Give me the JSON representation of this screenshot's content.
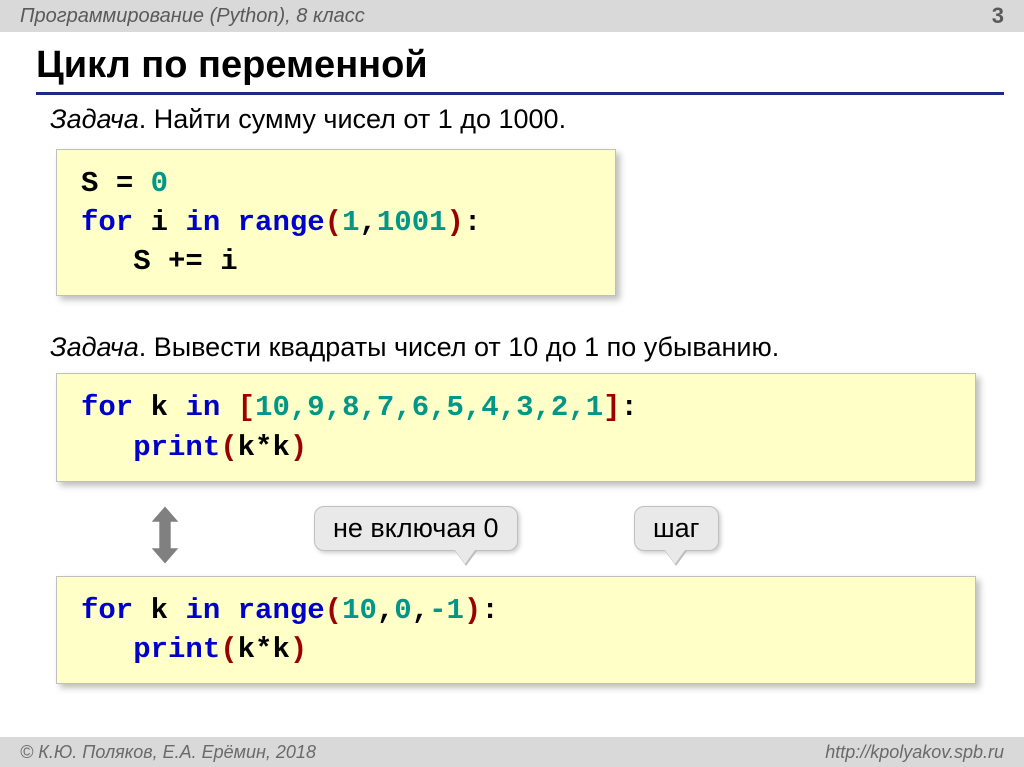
{
  "header": {
    "course": "Программирование (Python), 8 класс",
    "page": "3"
  },
  "title": "Цикл по переменной",
  "task1": {
    "label": "Задача",
    "text": ". Найти сумму чисел от 1 до 1000."
  },
  "code1": {
    "l1_a": "S ",
    "l1_eq": "= ",
    "l1_n": "0",
    "l2_for": "for ",
    "l2_i": "i ",
    "l2_in": "in ",
    "l2_range": "range",
    "l2_o": "(",
    "l2_n1": "1",
    "l2_c": ",",
    "l2_n2": "1001",
    "l2_cl": ")",
    "l2_colon": ":",
    "l3_ind": "   ",
    "l3_s": "S ",
    "l3_pe": "+= ",
    "l3_i": "i"
  },
  "task2": {
    "label": "Задача",
    "text": ". Вывести квадраты чисел от 10 до 1 по убыванию."
  },
  "code2": {
    "l1_for": "for ",
    "l1_k": "k ",
    "l1_in": "in ",
    "l1_o": "[",
    "l1_list": "10,9,8,7,6,5,4,3,2,1",
    "l1_cl": "]",
    "l1_colon": ":",
    "l2_ind": "   ",
    "l2_print": "print",
    "l2_o": "(",
    "l2_expr": "k*k",
    "l2_c": ")"
  },
  "callouts": {
    "not_including_zero": "не включая 0",
    "step": "шаг"
  },
  "code3": {
    "l1_for": "for ",
    "l1_k": "k ",
    "l1_in": "in ",
    "l1_range": "range",
    "l1_o": "(",
    "l1_n1": "10",
    "l1_c1": ",",
    "l1_n2": "0",
    "l1_c2": ",",
    "l1_n3": "-1",
    "l1_cl": ")",
    "l1_colon": ":",
    "l2_ind": "   ",
    "l2_print": "print",
    "l2_o": "(",
    "l2_expr": "k*k",
    "l2_c": ")"
  },
  "footer": {
    "copyright": "© К.Ю. Поляков, Е.А. Ерёмин, 2018",
    "url": "http://kpolyakov.spb.ru"
  }
}
